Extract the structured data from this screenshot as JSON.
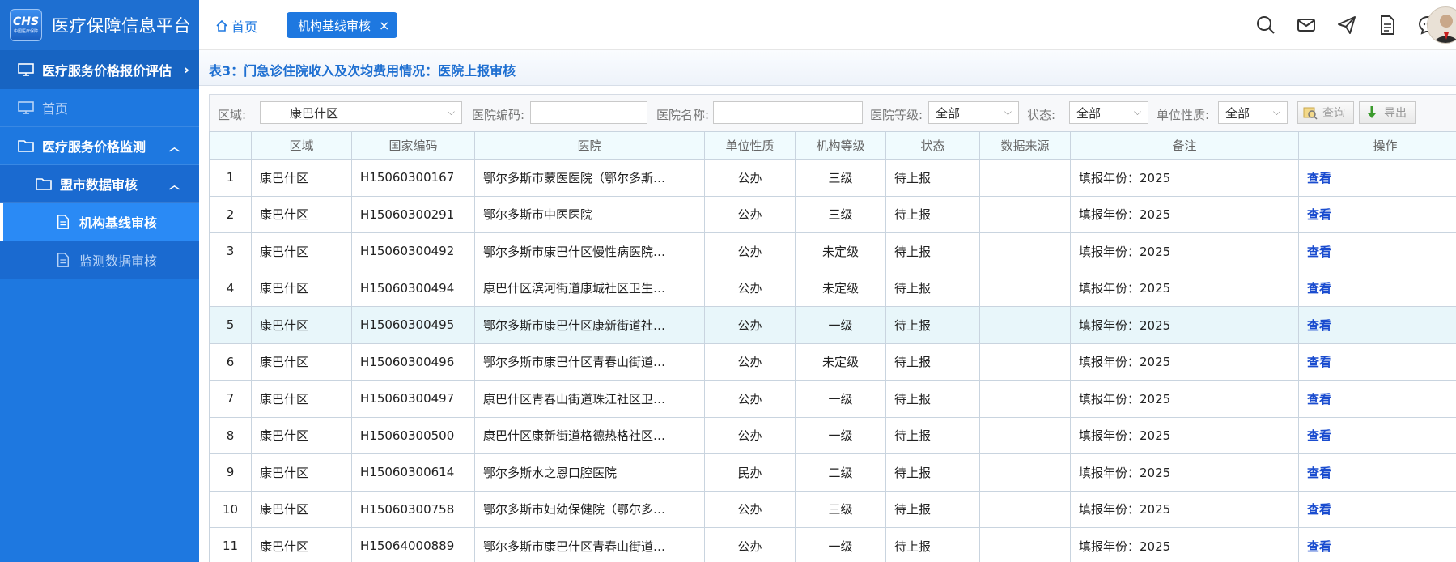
{
  "app": {
    "logo_text": "CHS",
    "logo_sub": "中国医疗保障",
    "title": "医疗保障信息平台"
  },
  "sidebar": {
    "top_item": "医疗服务价格报价评估",
    "items": [
      {
        "label": "首页"
      },
      {
        "label": "医疗服务价格监测"
      },
      {
        "label": "盟市数据审核"
      },
      {
        "label": "机构基线审核"
      },
      {
        "label": "监测数据审核"
      }
    ]
  },
  "header": {
    "home": "首页",
    "active_tab": "机构基线审核",
    "close": "×"
  },
  "page_title": "表3：门急诊住院收入及次均费用情况：医院上报审核",
  "filters": {
    "region_label": "区域:",
    "region_value": "康巴什区",
    "code_label": "医院编码:",
    "code_value": "",
    "name_label": "医院名称:",
    "name_value": "",
    "grade_label": "医院等级:",
    "grade_value": "全部",
    "status_label": "状态:",
    "status_value": "全部",
    "nature_label": "单位性质:",
    "nature_value": "全部",
    "query_btn": "查询",
    "export_btn": "导出"
  },
  "table": {
    "headers": [
      "",
      "区域",
      "国家编码",
      "医院",
      "单位性质",
      "机构等级",
      "状态",
      "数据来源",
      "备注",
      "操作"
    ],
    "rows": [
      {
        "n": "1",
        "region": "康巴什区",
        "code": "H15060300167",
        "hospital": "鄂尔多斯市蒙医医院（鄂尔多斯…",
        "nature": "公办",
        "grade": "三级",
        "status": "待上报",
        "source": "",
        "note": "填报年份：2025",
        "op": "查看"
      },
      {
        "n": "2",
        "region": "康巴什区",
        "code": "H15060300291",
        "hospital": "鄂尔多斯市中医医院",
        "nature": "公办",
        "grade": "三级",
        "status": "待上报",
        "source": "",
        "note": "填报年份：2025",
        "op": "查看"
      },
      {
        "n": "3",
        "region": "康巴什区",
        "code": "H15060300492",
        "hospital": "鄂尔多斯市康巴什区慢性病医院…",
        "nature": "公办",
        "grade": "未定级",
        "status": "待上报",
        "source": "",
        "note": "填报年份：2025",
        "op": "查看"
      },
      {
        "n": "4",
        "region": "康巴什区",
        "code": "H15060300494",
        "hospital": "康巴什区滨河街道康城社区卫生…",
        "nature": "公办",
        "grade": "未定级",
        "status": "待上报",
        "source": "",
        "note": "填报年份：2025",
        "op": "查看"
      },
      {
        "n": "5",
        "region": "康巴什区",
        "code": "H15060300495",
        "hospital": "鄂尔多斯市康巴什区康新街道社…",
        "nature": "公办",
        "grade": "一级",
        "status": "待上报",
        "source": "",
        "note": "填报年份：2025",
        "op": "查看"
      },
      {
        "n": "6",
        "region": "康巴什区",
        "code": "H15060300496",
        "hospital": "鄂尔多斯市康巴什区青春山街道…",
        "nature": "公办",
        "grade": "未定级",
        "status": "待上报",
        "source": "",
        "note": "填报年份：2025",
        "op": "查看"
      },
      {
        "n": "7",
        "region": "康巴什区",
        "code": "H15060300497",
        "hospital": "康巴什区青春山街道珠江社区卫…",
        "nature": "公办",
        "grade": "一级",
        "status": "待上报",
        "source": "",
        "note": "填报年份：2025",
        "op": "查看"
      },
      {
        "n": "8",
        "region": "康巴什区",
        "code": "H15060300500",
        "hospital": "康巴什区康新街道格德热格社区…",
        "nature": "公办",
        "grade": "一级",
        "status": "待上报",
        "source": "",
        "note": "填报年份：2025",
        "op": "查看"
      },
      {
        "n": "9",
        "region": "康巴什区",
        "code": "H15060300614",
        "hospital": "鄂尔多斯水之恩口腔医院",
        "nature": "民办",
        "grade": "二级",
        "status": "待上报",
        "source": "",
        "note": "填报年份：2025",
        "op": "查看"
      },
      {
        "n": "10",
        "region": "康巴什区",
        "code": "H15060300758",
        "hospital": "鄂尔多斯市妇幼保健院（鄂尔多…",
        "nature": "公办",
        "grade": "三级",
        "status": "待上报",
        "source": "",
        "note": "填报年份：2025",
        "op": "查看"
      },
      {
        "n": "11",
        "region": "康巴什区",
        "code": "H15064000889",
        "hospital": "鄂尔多斯市康巴什区青春山街道…",
        "nature": "公办",
        "grade": "一级",
        "status": "待上报",
        "source": "",
        "note": "填报年份：2025",
        "op": "查看"
      }
    ]
  },
  "icons": {
    "header": [
      "search-icon",
      "mail-icon",
      "send-icon",
      "document-icon",
      "chat-icon"
    ]
  },
  "colors": {
    "primary": "#1e78e0",
    "sidebar_dark": "#1764c2",
    "active_item": "#2a8af5",
    "link": "#1a4ccf",
    "row_highlight": "#e8f6fa"
  }
}
